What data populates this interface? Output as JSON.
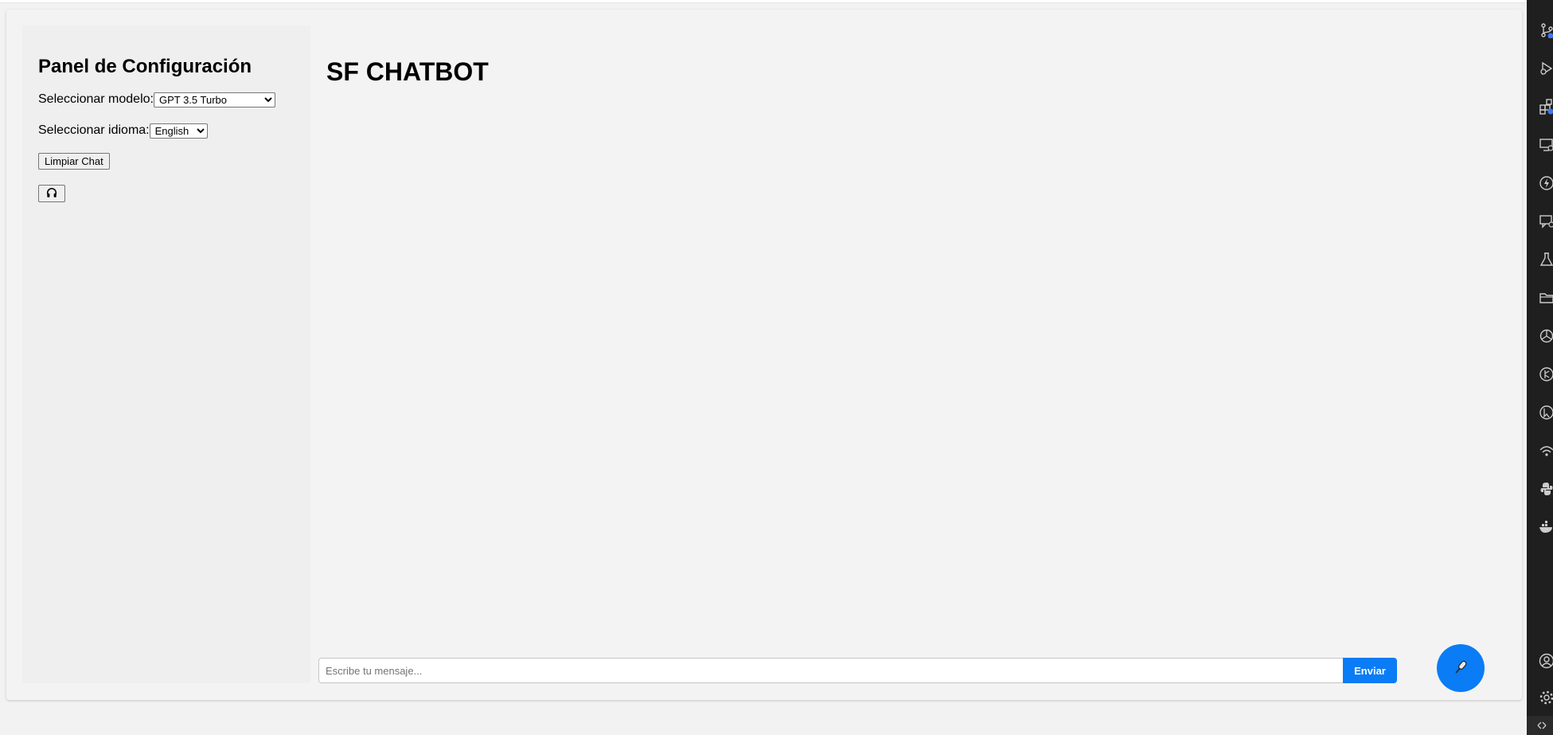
{
  "sidebar": {
    "title": "Panel de Configuración",
    "model_label": "Seleccionar modelo:",
    "model_selected": "GPT 3.5 Turbo",
    "language_label": "Seleccionar idioma:",
    "language_selected": "English",
    "clear_button": "Limpiar Chat",
    "audio_button_icon": "headphones-icon"
  },
  "main": {
    "title": "SF CHATBOT"
  },
  "chat": {
    "input_placeholder": "Escribe tu mensaje...",
    "send_button": "Enviar",
    "mic_button_icon": "microphone-icon"
  },
  "activity_bar": {
    "icons": [
      "source-control-icon",
      "run-debug-icon",
      "extensions-icon",
      "remote-explorer-icon",
      "lightning-icon",
      "chat-icon",
      "testing-icon",
      "folder-icon",
      "openai-icon",
      "gitlens-icon",
      "cursor-icon",
      "wifi-icon",
      "python-icon",
      "docker-icon",
      "account-icon",
      "settings-icon"
    ]
  },
  "colors": {
    "accent": "#0a7cf5",
    "page_background": "#f2f2f2",
    "sidebar_background": "#efefef",
    "activity_bar": "#1f1f1f"
  }
}
